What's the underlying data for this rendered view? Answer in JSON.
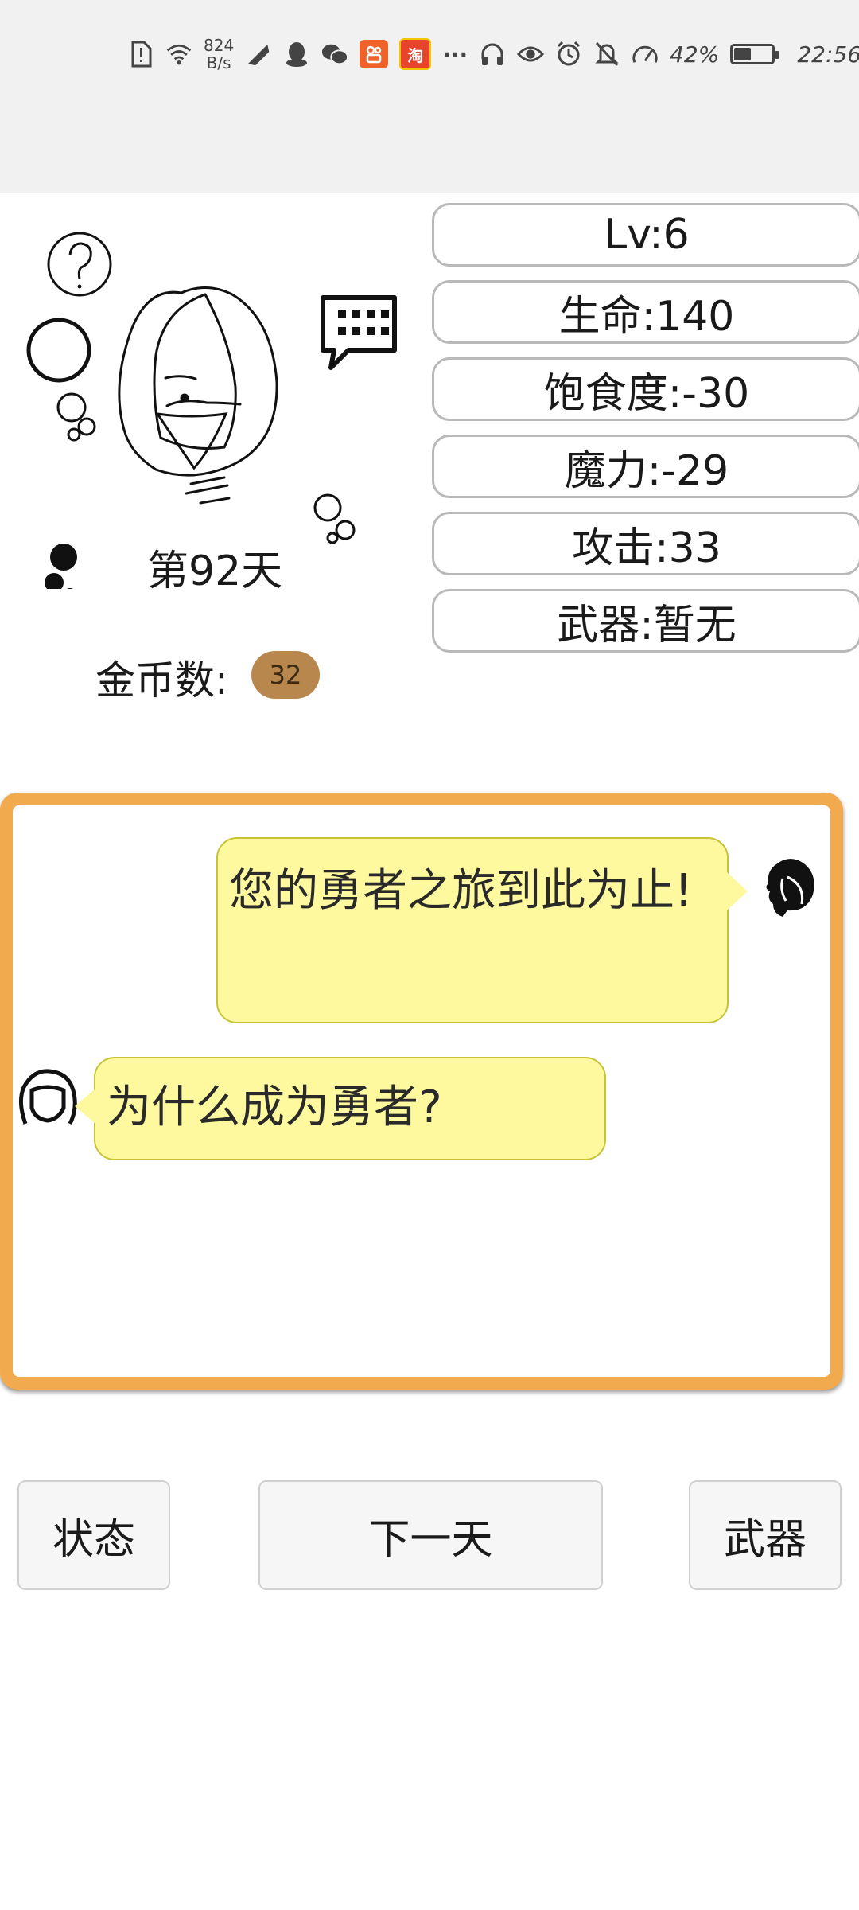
{
  "status_bar": {
    "net_speed_value": "824",
    "net_speed_unit": "B/s",
    "more": "···",
    "battery_percent": "42%",
    "battery_level": 0.42,
    "time": "22:56",
    "app_icons": [
      "sim-alert-icon",
      "wifi-icon",
      "signal-icon",
      "qq-icon",
      "wechat-icon",
      "kuaishou-icon",
      "taobao-icon"
    ],
    "right_icons": [
      "headphones-icon",
      "eye-icon",
      "alarm-icon",
      "mute-icon",
      "speed-icon"
    ],
    "taobao_text": "淘"
  },
  "player": {
    "day_label": "第92天",
    "gold_label": "金币数:",
    "gold_value": "32"
  },
  "stats": {
    "level": "Lv:6",
    "hp": "生命:140",
    "satiety": "饱食度:-30",
    "mana": "魔力:-29",
    "attack": "攻击:33",
    "weapon": "武器:暂无"
  },
  "chat": {
    "msg_right": "您的勇者之旅到此为止!",
    "msg_left": "为什么成为勇者?"
  },
  "buttons": {
    "status": "状态",
    "next_day": "下一天",
    "weapon": "武器"
  },
  "colors": {
    "panel_border": "#f1ab4e",
    "bubble_fill": "#fef99e",
    "gold_badge": "#b8874d"
  }
}
